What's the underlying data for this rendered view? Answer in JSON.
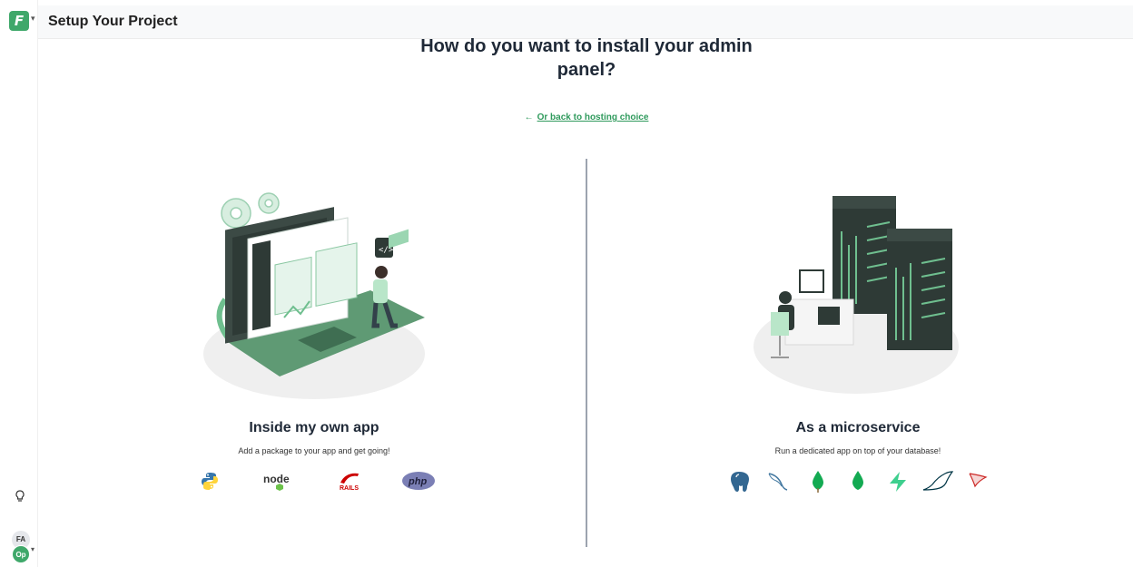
{
  "app": {
    "logo_letter": "F",
    "title": "Setup Your Project"
  },
  "heading": "How do you want to install your admin panel?",
  "back_link": {
    "arrow": "←",
    "label": "Or back to hosting choice"
  },
  "user": {
    "initials": "FA",
    "workspace": "Op"
  },
  "options": [
    {
      "title": "Inside my own app",
      "subtitle": "Add a package to your app and get going!",
      "technologies": [
        "python-icon",
        "node-icon",
        "rails-icon",
        "php-icon"
      ],
      "tech_labels": {
        "node": "node",
        "rails": "RAILS",
        "php": "php"
      }
    },
    {
      "title": "As a microservice",
      "subtitle": "Run a dedicated app on top of your database!",
      "technologies": [
        "postgresql-icon",
        "mysql-icon",
        "mongodb-icon",
        "mongodb-alt-icon",
        "supabase-icon",
        "mariadb-icon",
        "sqlserver-icon"
      ]
    }
  ],
  "colors": {
    "accent": "#3fa86a",
    "link": "#2f9a5c",
    "illustration_dark": "#2e3a36",
    "illustration_green": "#6fbf8f"
  }
}
